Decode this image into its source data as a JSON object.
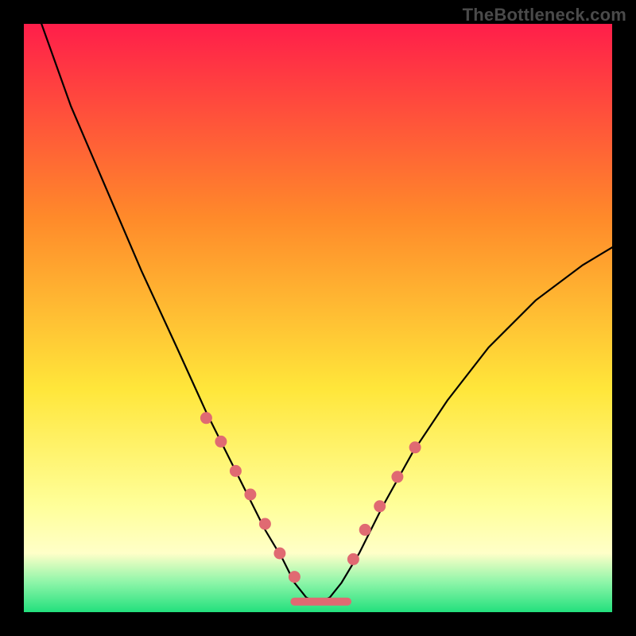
{
  "watermark": "TheBottleneck.com",
  "colors": {
    "bg_black": "#000000",
    "grad_top": "#ff1e4a",
    "grad_mid1": "#ff8a2a",
    "grad_mid2": "#ffe63a",
    "grad_pale": "#ffffaa",
    "grad_green": "#23f08a",
    "curve": "#000000",
    "marker": "#e06a72"
  },
  "chart_data": {
    "type": "line",
    "title": "",
    "xlabel": "",
    "ylabel": "",
    "xlim": [
      0,
      100
    ],
    "ylim": [
      0,
      100
    ],
    "series": [
      {
        "name": "bottleneck-curve",
        "x": [
          3,
          8,
          14,
          20,
          26,
          31,
          35,
          38,
          41,
          44,
          46,
          48,
          50,
          52,
          54,
          57,
          61,
          66,
          72,
          79,
          87,
          95,
          100
        ],
        "y": [
          100,
          86,
          72,
          58,
          45,
          34,
          26,
          20,
          14,
          9,
          5,
          2.5,
          1.5,
          2.5,
          5,
          10,
          18,
          27,
          36,
          45,
          53,
          59,
          62
        ]
      }
    ],
    "markers": {
      "name": "highlight-dots",
      "x": [
        31,
        33.5,
        36,
        38.5,
        41,
        43.5,
        46,
        56,
        58,
        60.5,
        63.5,
        66.5
      ],
      "y": [
        33,
        29,
        24,
        20,
        15,
        10,
        6,
        9,
        14,
        18,
        23,
        28
      ]
    },
    "flat_segment": {
      "x0": 46,
      "x1": 55,
      "y": 1.8
    },
    "annotations": []
  }
}
